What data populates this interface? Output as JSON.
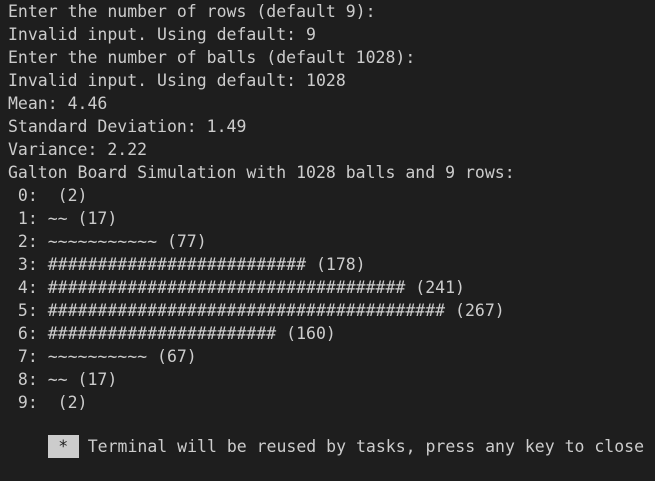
{
  "terminal": {
    "lines": [
      "Enter the number of rows (default 9):",
      "Invalid input. Using default: 9",
      "Enter the number of balls (default 1028):",
      "Invalid input. Using default: 1028",
      "Mean: 4.46",
      "Standard Deviation: 1.49",
      "Variance: 2.22",
      "Galton Board Simulation with 1028 balls and 9 rows:",
      " 0:  (2)",
      " 1: ~~ (17)",
      " 2: ~~~~~~~~~~~ (77)",
      " 3: ########################## (178)",
      " 4: #################################### (241)",
      " 5: ######################################## (267)",
      " 6: ####################### (160)",
      " 7: ~~~~~~~~~~ (67)",
      " 8: ~~ (17)",
      " 9:  (2)"
    ],
    "reuse_marker": "*",
    "reuse_message": "Terminal will be reused by tasks, press any key to close it."
  },
  "colors": {
    "background": "#1e1e1e",
    "foreground": "#cccccc"
  }
}
